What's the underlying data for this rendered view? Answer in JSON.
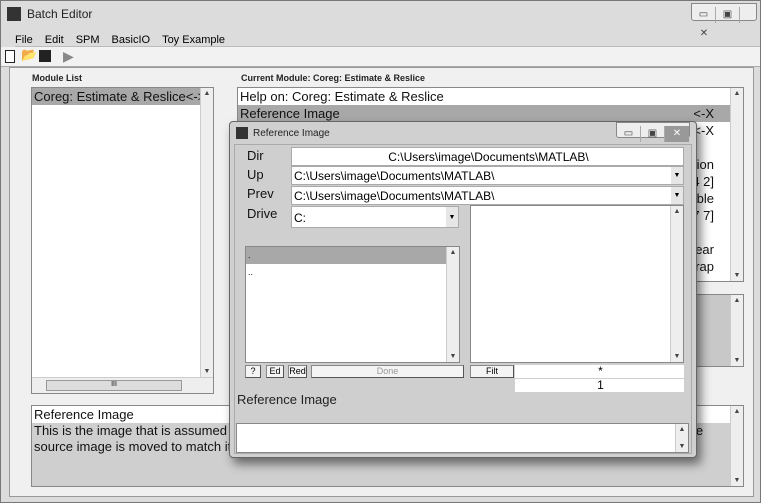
{
  "window": {
    "title": "Batch Editor",
    "controls": [
      "▭",
      "▣",
      "✕"
    ]
  },
  "menu": [
    "File",
    "Edit",
    "SPM",
    "BasicIO",
    "Toy Example"
  ],
  "toolbar": {
    "icons": [
      "new-icon",
      "open-icon",
      "save-icon",
      "run-icon"
    ]
  },
  "module_list": {
    "label": "Module List",
    "items": [
      "Coreg: Estimate & Reslice<->X"
    ]
  },
  "current_module": {
    "label": "Current Module: Coreg: Estimate & Reslice",
    "items": [
      {
        "text": "Help on: Coreg: Estimate & Reslice",
        "value": ""
      },
      {
        "text": "Reference Image",
        "value": "<-X"
      },
      {
        "text": "",
        "value": "<-X"
      },
      {
        "text": "",
        "value": ""
      },
      {
        "text": "",
        "value": "tion"
      },
      {
        "text": "",
        "value": "4 2]"
      },
      {
        "text": "",
        "value": "ble"
      },
      {
        "text": "",
        "value": "7 7]"
      },
      {
        "text": "",
        "value": ""
      },
      {
        "text": "",
        "value": "ear"
      },
      {
        "text": "",
        "value": "rap"
      }
    ]
  },
  "help": {
    "title": "Reference Image",
    "line1": "This is the image that is assumed to remain stationary (sometimes known as the target or template image), while the",
    "line2": "source image is moved to match it."
  },
  "dialog": {
    "title": "Reference Image",
    "dir_label": "Dir",
    "dir": "C:\\Users\\image\\Documents\\MATLAB\\",
    "up_label": "Up",
    "up": "C:\\Users\\image\\Documents\\MATLAB\\",
    "prev_label": "Prev",
    "prev": "C:\\Users\\image\\Documents\\MATLAB\\",
    "drive_label": "Drive",
    "drive": "C:",
    "dir_items": [
      ".",
      ".."
    ],
    "buttons": {
      "help": "?",
      "ed": "Ed",
      "red": "Red",
      "done": "Done",
      "filt": "Filt"
    },
    "filter": "*",
    "frames": "1",
    "prompt": "Reference Image",
    "selected": ""
  }
}
